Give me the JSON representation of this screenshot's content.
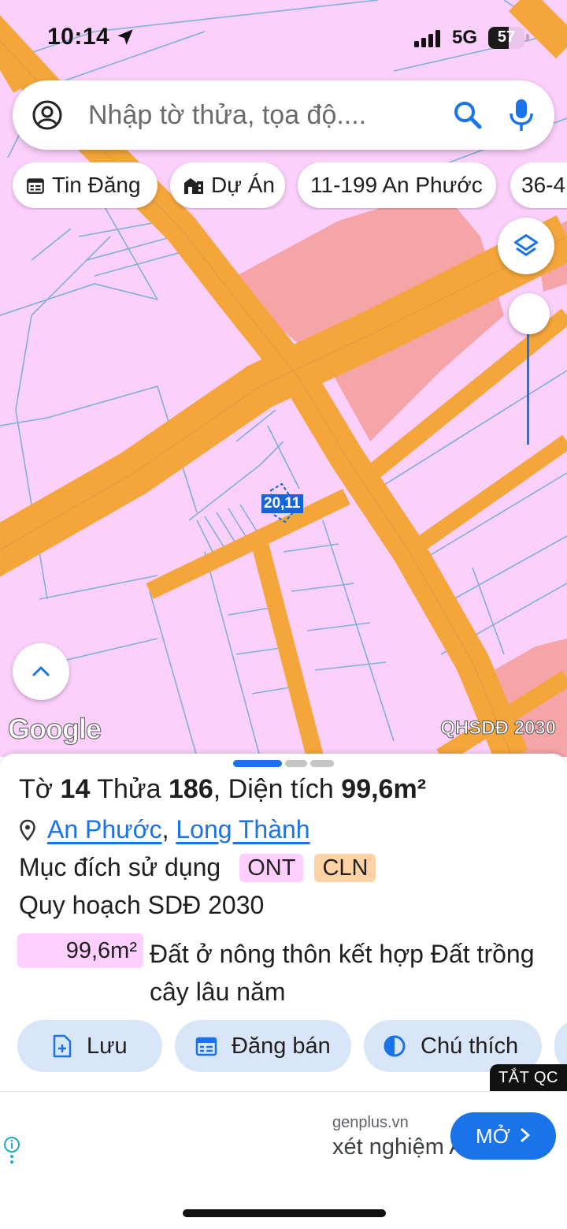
{
  "status_bar": {
    "time": "10:14",
    "network": "5G",
    "battery_percent": "57",
    "battery_level": 0.57,
    "location_icon": "location-arrow-icon",
    "signal_icon": "cellular-signal-icon"
  },
  "search": {
    "placeholder": "Nhập tờ thửa, tọa độ....",
    "account_icon": "account-circle-icon",
    "search_icon": "search-icon",
    "mic_icon": "microphone-icon"
  },
  "chips": [
    {
      "label": "Tin Đăng",
      "icon": "calendar-icon"
    },
    {
      "label": "Dự Án",
      "icon": "buildings-icon"
    },
    {
      "label": "11-199 An Phước",
      "icon": ""
    },
    {
      "label": "36-4",
      "icon": ""
    }
  ],
  "map": {
    "parcel_label": "20,11",
    "google_logo": "Google",
    "overlay_name": "QHSDĐ 2030",
    "opacity_level": 1.0,
    "colors": {
      "residential": "#fbd0fb",
      "road": "#f5a63a",
      "commercial": "#f5a4a8",
      "boundary": "#7fb0d8",
      "accent": "#1a73e8"
    }
  },
  "parcel": {
    "title_prefix": "Tờ",
    "sheet_number": "14",
    "plot_word": "Thửa",
    "plot_number": "186",
    "area_word": "Diện tích",
    "area": "99,6m²",
    "ward": "An Phước",
    "district": "Long Thành",
    "separator": ",",
    "purpose_label": "Mục đích sử dụng",
    "purpose_tags": [
      "ONT",
      "CLN"
    ],
    "plan_label": "Quy hoạch SDĐ 2030",
    "plan_area": "99,6m²",
    "plan_description": "Đất ở nông thôn kết hợp Đất trồng cây lâu năm"
  },
  "actions": [
    {
      "label": "Lưu",
      "icon": "file-add-icon"
    },
    {
      "label": "Đăng bán",
      "icon": "calendar-list-icon"
    },
    {
      "label": "Chú thích",
      "icon": "half-circle-icon"
    }
  ],
  "ad": {
    "close_label": "TẮT QC",
    "domain": "genplus.vn",
    "text": "xét nghiệm ADN",
    "open_label": "MỞ",
    "info_icon": "info-icon"
  }
}
